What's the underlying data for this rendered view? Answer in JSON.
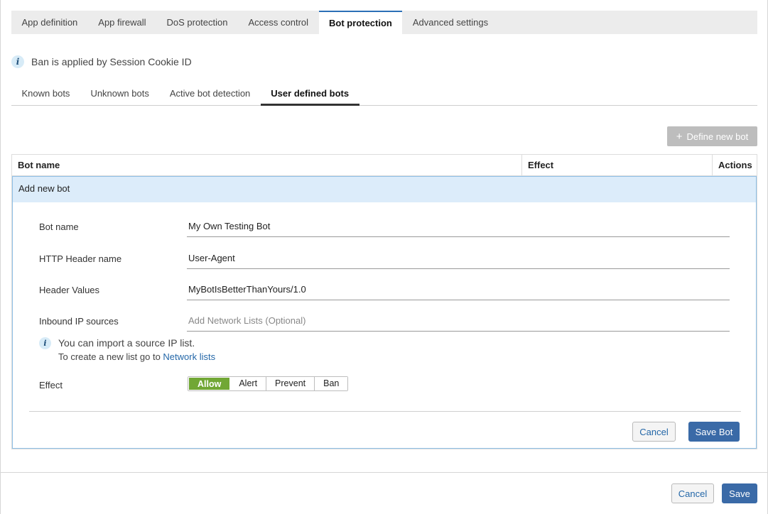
{
  "top_tabs": [
    {
      "label": "App definition",
      "active": false
    },
    {
      "label": "App firewall",
      "active": false
    },
    {
      "label": "DoS protection",
      "active": false
    },
    {
      "label": "Access control",
      "active": false
    },
    {
      "label": "Bot protection",
      "active": true
    },
    {
      "label": "Advanced settings",
      "active": false
    }
  ],
  "info": {
    "icon": "info-icon",
    "text": "Ban is applied by Session Cookie ID"
  },
  "sub_tabs": [
    {
      "label": "Known bots",
      "active": false
    },
    {
      "label": "Unknown bots",
      "active": false
    },
    {
      "label": "Active bot detection",
      "active": false
    },
    {
      "label": "User defined bots",
      "active": true
    }
  ],
  "define_button": {
    "icon": "plus-icon",
    "label": "Define new bot"
  },
  "table": {
    "columns": [
      "Bot name",
      "Effect",
      "Actions"
    ]
  },
  "add_bot": {
    "title": "Add new bot",
    "fields": {
      "bot_name": {
        "label": "Bot name",
        "value": "My Own Testing Bot"
      },
      "header_name": {
        "label": "HTTP Header name",
        "value": "User-Agent"
      },
      "header_values": {
        "label": "Header Values",
        "value": "MyBotIsBetterThanYours/1.0"
      },
      "inbound_ip": {
        "label": "Inbound IP sources",
        "value": "",
        "placeholder": "Add Network Lists (Optional)"
      }
    },
    "hint": {
      "line1": "You can import a source IP list.",
      "line2_prefix": "To create a new list go to ",
      "link": "Network lists"
    },
    "effect": {
      "label": "Effect",
      "options": [
        "Allow",
        "Alert",
        "Prevent",
        "Ban"
      ],
      "selected": "Allow",
      "selected_color": "#71a735"
    },
    "cancel_label": "Cancel",
    "save_label": "Save Bot"
  },
  "footer": {
    "cancel_label": "Cancel",
    "save_label": "Save"
  }
}
